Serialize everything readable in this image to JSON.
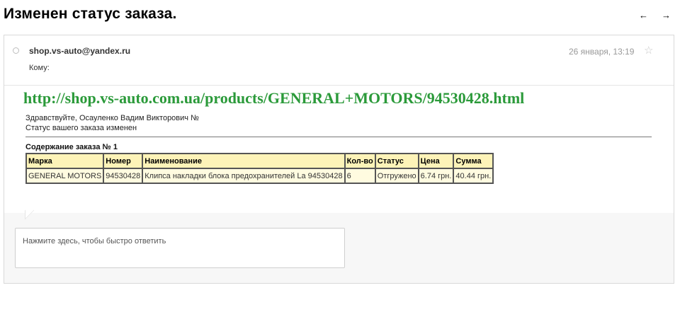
{
  "page": {
    "title": "Изменен статус заказа."
  },
  "nav": {
    "prev_icon": "←",
    "next_icon": "→"
  },
  "message": {
    "sender": "shop.vs-auto@yandex.ru",
    "to_label": "Кому:",
    "date": "26 января, 13:19",
    "star_icon": "☆"
  },
  "email": {
    "link": "http://shop.vs-auto.com.ua/products/GENERAL+MOTORS/94530428.html",
    "greeting": "Здравствуйте, Осауленко Вадим Викторович №",
    "status_line": "Статус вашего заказа изменен",
    "order_title": "Содержание заказа № 1",
    "table": {
      "headers": [
        "Марка",
        "Номер",
        "Наименование",
        "Кол-во",
        "Статус",
        "Цена",
        "Сумма"
      ],
      "rows": [
        [
          "GENERAL MOTORS",
          "94530428",
          "Клипса накладки блока предохранителей La 94530428",
          "6",
          "Отгружено",
          "6.74 грн.",
          "40.44 грн."
        ]
      ]
    }
  },
  "reply": {
    "placeholder": "Нажмите здесь, чтобы быстро ответить"
  },
  "colors": {
    "link": "#2b9a3a",
    "table_header_bg": "#fdf3b8",
    "table_cell_bg": "#fffbe0"
  }
}
